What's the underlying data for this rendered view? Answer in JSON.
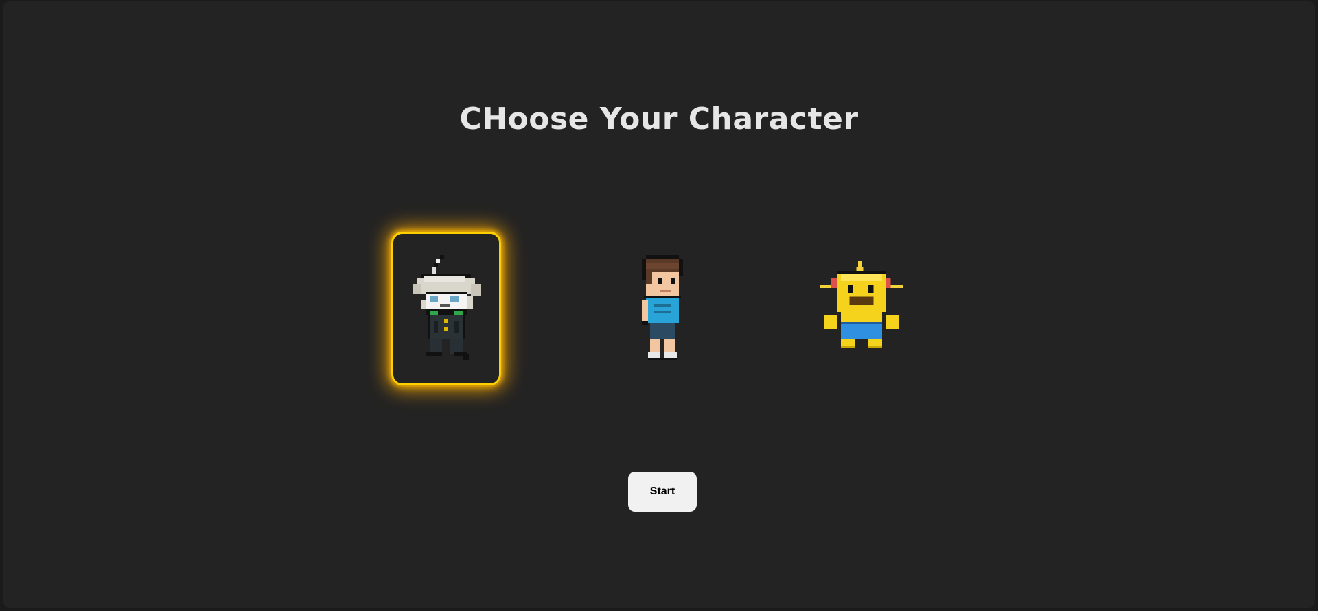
{
  "screen": {
    "title": "CHoose Your Character",
    "start_label": "Start",
    "selected_index": 0
  },
  "characters": [
    {
      "id": "white-haired-boy",
      "selected": true
    },
    {
      "id": "brown-haired-boy",
      "selected": false
    },
    {
      "id": "yellow-creature",
      "selected": false
    }
  ],
  "colors": {
    "background": "#232323",
    "title": "#e6e6e6",
    "selection_border": "#ffd000",
    "selection_glow": "#ffaa00",
    "button_bg": "#f1f1f1"
  }
}
